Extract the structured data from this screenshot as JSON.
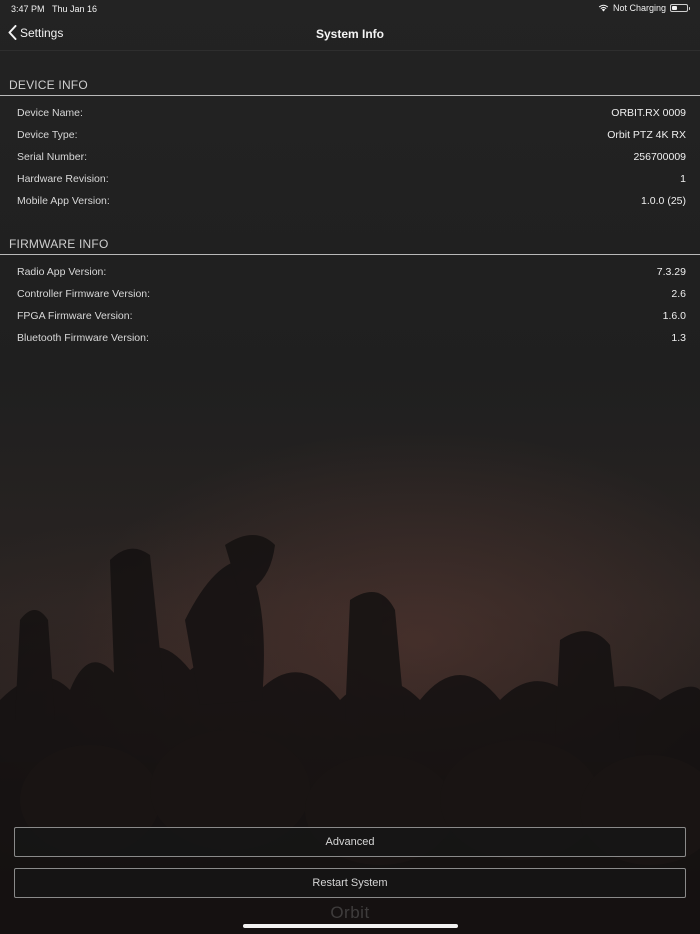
{
  "status_bar": {
    "time": "3:47 PM",
    "date": "Thu Jan 16",
    "charging_text": "Not Charging",
    "battery_level": 0.35
  },
  "nav": {
    "back_label": "Settings",
    "title": "System Info"
  },
  "device_info": {
    "header": "DEVICE INFO",
    "rows": [
      {
        "label": "Device Name:",
        "value": "ORBIT.RX 0009"
      },
      {
        "label": "Device Type:",
        "value": "Orbit PTZ 4K RX"
      },
      {
        "label": "Serial Number:",
        "value": "256700009"
      },
      {
        "label": "Hardware Revision:",
        "value": "1"
      },
      {
        "label": "Mobile App Version:",
        "value": "1.0.0 (25)"
      }
    ]
  },
  "firmware_info": {
    "header": "FIRMWARE INFO",
    "rows": [
      {
        "label": "Radio App Version:",
        "value": "7.3.29"
      },
      {
        "label": "Controller Firmware Version:",
        "value": "2.6"
      },
      {
        "label": "FPGA Firmware Version:",
        "value": "1.6.0"
      },
      {
        "label": "Bluetooth Firmware Version:",
        "value": "1.3"
      }
    ]
  },
  "buttons": {
    "advanced": "Advanced",
    "restart": "Restart System"
  },
  "brand": "Orbit",
  "colors": {
    "background": "#1b1b1b",
    "text": "#e6e6e6",
    "button_border": "#8a8a8a"
  }
}
